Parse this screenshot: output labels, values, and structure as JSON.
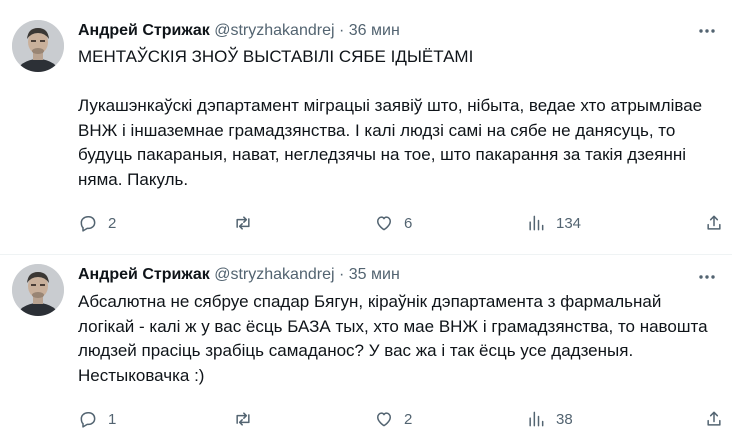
{
  "tweets": [
    {
      "author_name": "Андрей Стрижак",
      "handle": "@stryzhakandrej",
      "separator": "·",
      "time": "36 мин",
      "title_line": "МЕНТАЎСКІЯ ЗНОЎ ВЫСТАВІЛІ СЯБЕ ІДЫЁТАМІ",
      "paragraph": "Лукашэнкаўскі дэпартамент міграцыі заявіў што, нібыта, ведае хто атрымлівае ВНЖ і іншаземнае грамадзянства. І калі людзі самі на сябе не данясуць, то будуць пакараныя, нават, негледзячы на тое, што пакарання за такія дзеянні няма. Пакуль.",
      "replies": "2",
      "retweets": "",
      "likes": "6",
      "views": "134"
    },
    {
      "author_name": "Андрей Стрижак",
      "handle": "@stryzhakandrej",
      "separator": "·",
      "time": "35 мин",
      "paragraph": "Абсалютна не сябруе спадар Бягун, кіраўнік дэпартамента з фармальнай логікай - калі ж у вас ёсць БАЗА тых, хто мае ВНЖ і грамадзянства, то навошта людзей прасіць зрабіць самаданос? У вас жа і так ёсць усе дадзеныя. Нестыковачка :)",
      "replies": "1",
      "retweets": "",
      "likes": "2",
      "views": "38"
    }
  ],
  "icons": {
    "reply": "reply-icon",
    "retweet": "retweet-icon",
    "like": "like-icon",
    "views": "views-icon",
    "share": "share-icon",
    "more": "more-icon"
  },
  "colors": {
    "text": "#0f1419",
    "secondary": "#536471",
    "divider": "#eff3f4"
  }
}
